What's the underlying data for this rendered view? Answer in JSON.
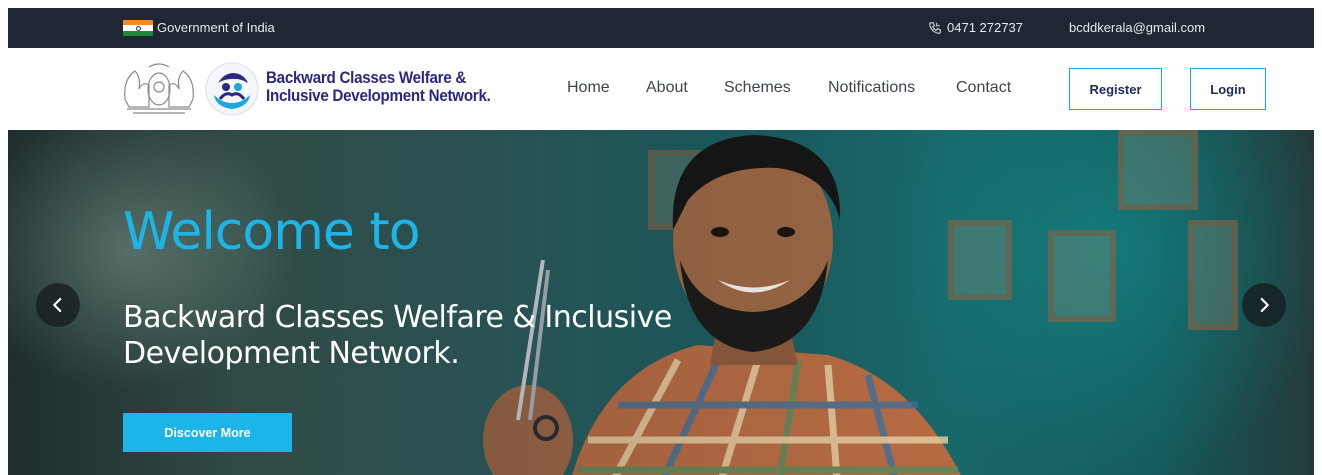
{
  "topbar": {
    "government_label": "Government of India",
    "phone": "0471 272737",
    "email": "bcddkerala@gmail.com"
  },
  "header": {
    "brand_line1": "Backward Classes Welfare &",
    "brand_line2": "Inclusive Development Network.",
    "nav": {
      "home": "Home",
      "about": "About",
      "schemes": "Schemes",
      "notifications": "Notifications",
      "contact": "Contact"
    },
    "register_label": "Register",
    "login_label": "Login"
  },
  "hero": {
    "welcome": "Welcome to",
    "subtitle": "Backward Classes Welfare & Inclusive Development Network.",
    "cta_label": "Discover More"
  },
  "colors": {
    "topbar_bg": "#1f2734",
    "brand": "#2a2882",
    "accent": "#1db4e8",
    "nav_text": "#3f4650"
  },
  "icons": {
    "flag": "india-flag-icon",
    "phone": "phone-icon",
    "prev": "chevron-left-icon",
    "next": "chevron-right-icon"
  }
}
